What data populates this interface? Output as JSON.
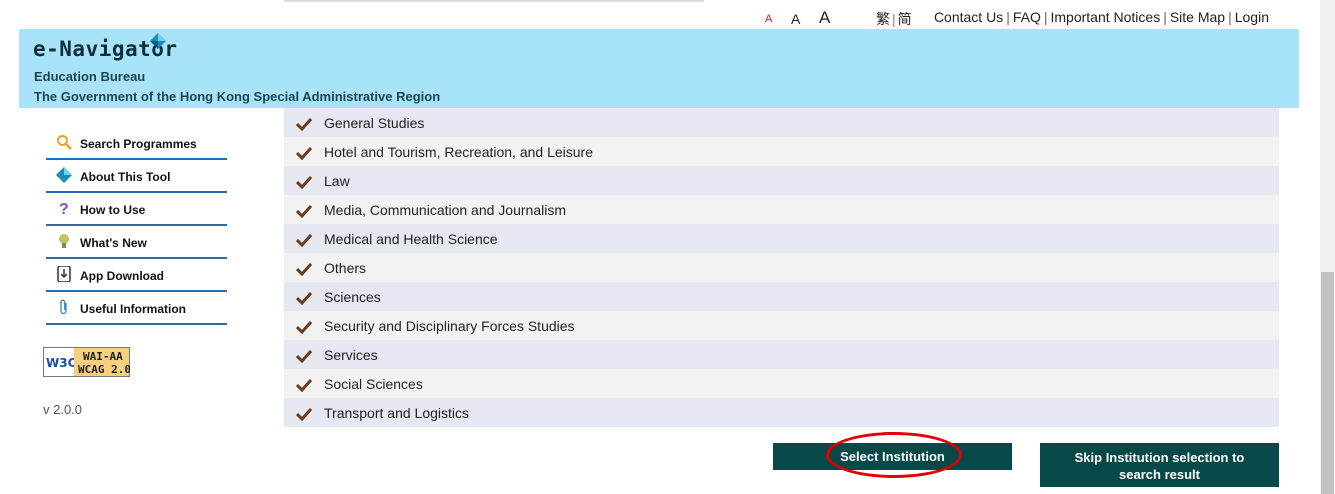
{
  "font_sizes": {
    "small": "A",
    "medium": "A",
    "large": "A"
  },
  "language": {
    "traditional": "繁",
    "separator": "|",
    "simplified": "简"
  },
  "top_links": [
    "Contact Us",
    "FAQ",
    "Important Notices",
    "Site Map",
    "Login"
  ],
  "header": {
    "logo_text": "e-Navigator",
    "org_line1": "Education Bureau",
    "org_line2": "The Government of the Hong Kong Special Administrative Region"
  },
  "sidebar": {
    "items": [
      {
        "label": "Search Programmes",
        "icon": "magnifier-icon"
      },
      {
        "label": "About This Tool",
        "icon": "navigator-logo-icon"
      },
      {
        "label": "How to Use",
        "icon": "question-mark-icon"
      },
      {
        "label": "What's New",
        "icon": "lightbulb-icon"
      },
      {
        "label": "App Download",
        "icon": "download-icon"
      },
      {
        "label": "Useful Information",
        "icon": "paperclip-icon"
      }
    ],
    "badge_line1": "WAI-AA",
    "badge_line2": "WCAG 2.0",
    "badge_w3c": "W3C",
    "version": "v 2.0.0"
  },
  "categories": [
    "General Studies",
    "Hotel and Tourism, Recreation, and Leisure",
    "Law",
    "Media, Communication and Journalism",
    "Medical and Health Science",
    "Others",
    "Sciences",
    "Security and Disciplinary Forces Studies",
    "Services",
    "Social Sciences",
    "Transport and Logistics"
  ],
  "buttons": {
    "select_institution": "Select Institution",
    "skip_line1": "Skip Institution selection to",
    "skip_line2": "search result"
  },
  "colors": {
    "banner": "#a8e3fa",
    "button": "#074948",
    "highlight": "#e00000",
    "checkmark": "#6b3b1c"
  }
}
